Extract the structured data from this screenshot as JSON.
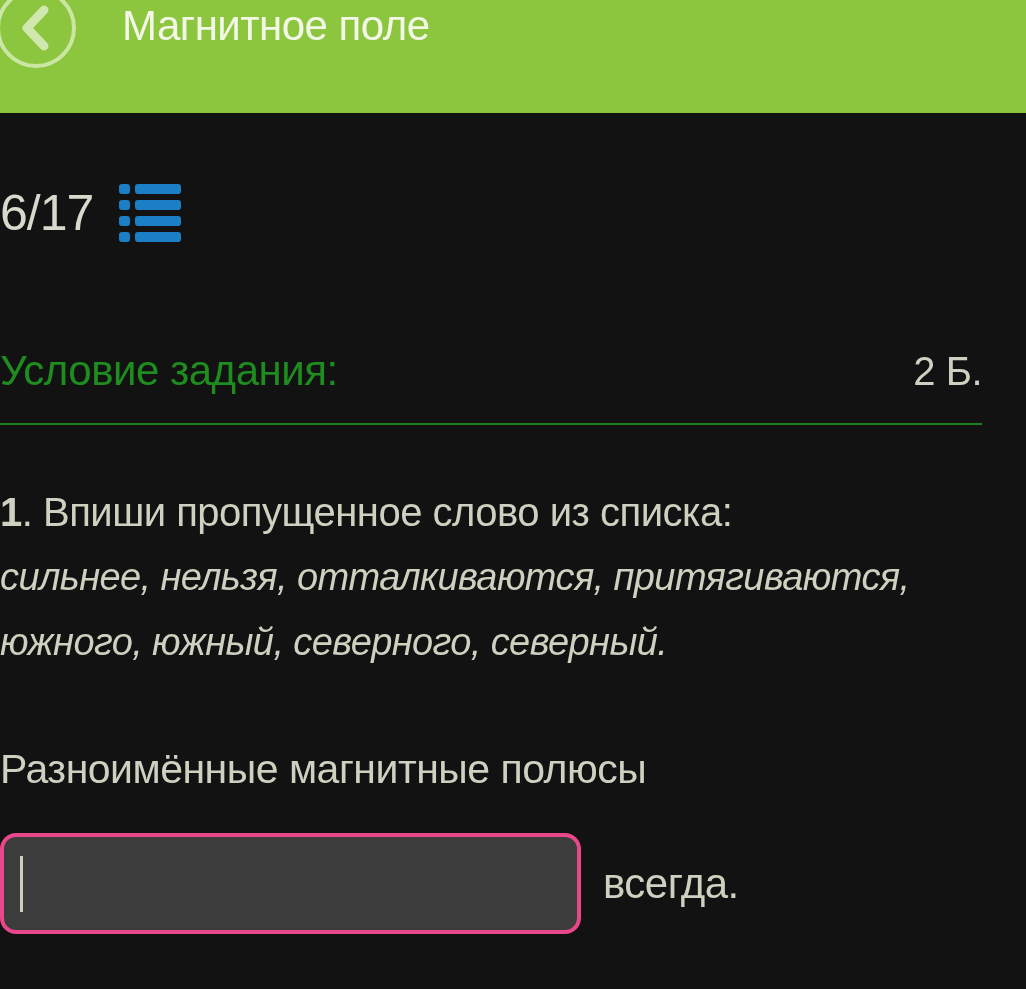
{
  "header": {
    "title": "Магнитное поле"
  },
  "progress": {
    "counter": "6/17"
  },
  "task": {
    "heading": "Условие задания:",
    "points": "2 Б.",
    "prompt": "**1**. Впиши пропущенное слово из списка:",
    "word_list": "сильнее, нельзя, отталкиваются, притягиваются, южного, южный, северного, северный.",
    "sentence_start": "Разноимённые магнитные полюсы",
    "answer": {
      "focused": true
    },
    "sentence_end": "всегда."
  }
}
